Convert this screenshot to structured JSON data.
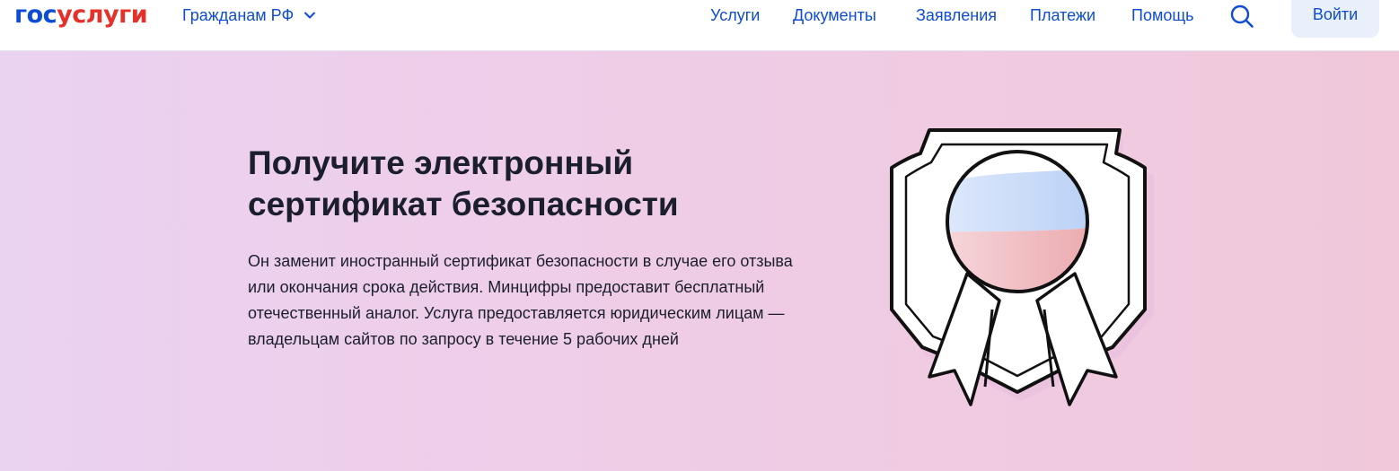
{
  "header": {
    "logo": {
      "part1": "гос",
      "part2": "услуги"
    },
    "region_label": "Гражданам РФ",
    "nav": [
      {
        "label": "Услуги"
      },
      {
        "label": "Документы"
      },
      {
        "label": "Заявления"
      },
      {
        "label": "Платежи"
      },
      {
        "label": "Помощь"
      }
    ],
    "login_label": "Войти"
  },
  "hero": {
    "title": "Получите электронный сертификат безопасности",
    "description": "Он заменит иностранный сертификат безопасности в случае его отзыва или окончания срока действия. Минцифры предоставит бесплатный отечественный аналог. Услуга предоставляется юридическим лицам — владельцам сайтов по запросу в течение 5 рабочих дней"
  },
  "colors": {
    "brand_blue": "#0d4cd3",
    "brand_red": "#e4322b",
    "text_dark": "#1b1e2c",
    "login_bg": "#e9f0fb"
  },
  "icons": {
    "region_chevron": "chevron-down-icon",
    "search": "search-icon",
    "illustration": "certificate-badge-icon"
  }
}
